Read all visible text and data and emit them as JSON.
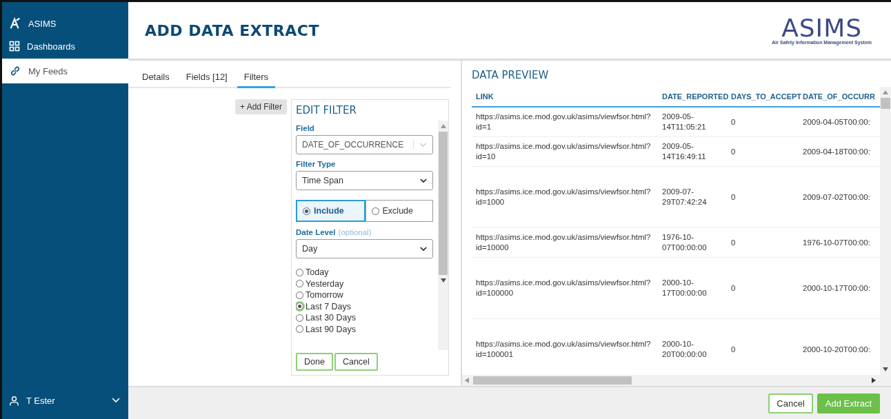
{
  "sidebar": {
    "brand": "ASIMS",
    "items": [
      {
        "label": "Dashboards",
        "selected": false
      },
      {
        "label": "My Feeds",
        "selected": true
      }
    ],
    "user": "T Ester"
  },
  "header": {
    "title": "ADD DATA EXTRACT",
    "logo": "ASIMS",
    "logo_subtitle": "Air Safety Information Management System"
  },
  "tabs": [
    {
      "label": "Details",
      "selected": false
    },
    {
      "label": "Fields [12]",
      "selected": false
    },
    {
      "label": "Filters",
      "selected": true
    }
  ],
  "add_filter": "+ Add Filter",
  "edit_filter": {
    "title": "EDIT FILTER",
    "field_label": "Field",
    "field_value": "DATE_OF_OCCURRENCE",
    "filter_type_label": "Filter Type",
    "filter_type_value": "Time Span",
    "modes": [
      {
        "label": "Include",
        "selected": true
      },
      {
        "label": "Exclude",
        "selected": false
      }
    ],
    "date_level_label": "Date Level",
    "date_level_hint": "(optional)",
    "date_level_value": "Day",
    "spans": [
      {
        "label": "Today",
        "selected": false
      },
      {
        "label": "Yesterday",
        "selected": false
      },
      {
        "label": "Tomorrow",
        "selected": false
      },
      {
        "label": "Last 7 Days",
        "selected": true
      },
      {
        "label": "Last 30 Days",
        "selected": false
      },
      {
        "label": "Last 90 Days",
        "selected": false
      }
    ],
    "buttons": [
      "Done",
      "Cancel"
    ]
  },
  "preview": {
    "title": "DATA PREVIEW",
    "columns": [
      "LINK",
      "DATE_REPORTED",
      "DAYS_TO_ACCEPT",
      "DATE_OF_OCCURR"
    ],
    "rows": [
      {
        "cells": [
          "https://asims.ice.mod.gov.uk/asims/viewfsor.html?id=1",
          "2009-05-14T11:05:21",
          "0",
          "2009-04-05T00:00:"
        ]
      },
      {
        "cells": [
          "https://asims.ice.mod.gov.uk/asims/viewfsor.html?id=10",
          "2009-05-14T16:49:11",
          "0",
          "2009-04-18T00:00:"
        ]
      },
      {
        "cells": [
          "https://asims.ice.mod.gov.uk/asims/viewfsor.html?id=1000",
          "2009-07-29T07:42:24",
          "0",
          "2009-07-02T00:00:"
        ]
      },
      {
        "cells": [
          "https://asims.ice.mod.gov.uk/asims/viewfsor.html?id=10000",
          "1976-10-07T00:00:00",
          "0",
          "1976-10-07T00:00:"
        ]
      },
      {
        "cells": [
          "https://asims.ice.mod.gov.uk/asims/viewfsor.html?id=100000",
          "2000-10-17T00:00:00",
          "0",
          "2000-10-17T00:00:"
        ]
      },
      {
        "cells": [
          "https://asims.ice.mod.gov.uk/asims/viewfsor.html?id=100001",
          "2000-10-20T00:00:00",
          "0",
          "2000-10-20T00:00:"
        ]
      }
    ]
  },
  "footer_buttons": [
    "Cancel",
    "Add Extract"
  ]
}
